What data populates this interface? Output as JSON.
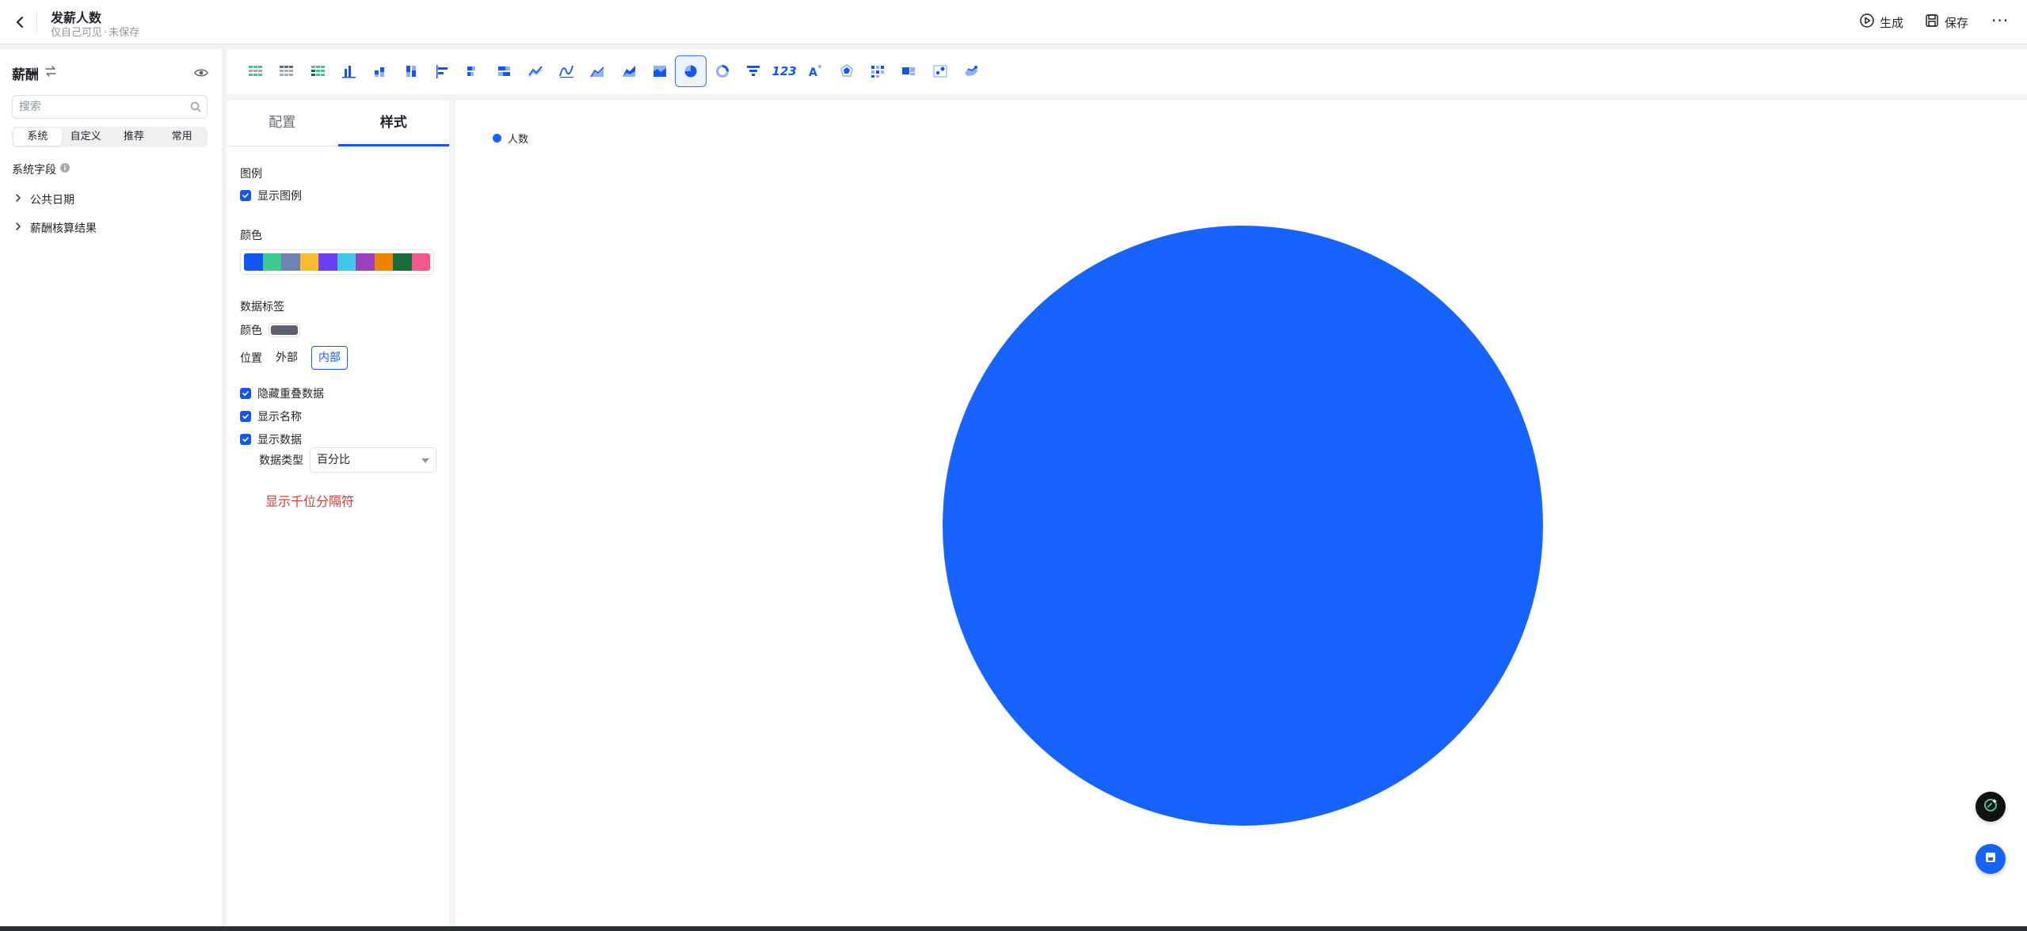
{
  "header": {
    "title": "发薪人数",
    "subtitle_visibility": "仅自己可见",
    "subtitle_status": "未保存",
    "generate_label": "生成",
    "save_label": "保存",
    "more_label": "···"
  },
  "sidebar": {
    "title": "薪酬",
    "search_placeholder": "搜索",
    "segments": [
      "系统",
      "自定义",
      "推荐",
      "常用"
    ],
    "active_segment": "系统",
    "section_label": "系统字段",
    "tree": [
      {
        "label": "公共日期"
      },
      {
        "label": "薪酬核算结果"
      }
    ]
  },
  "toolbar": {
    "chart_types": [
      "detail-table-icon",
      "cross-table-icon",
      "group-table-icon",
      "column-chart-icon",
      "stacked-column-icon",
      "percent-column-icon",
      "bar-chart-icon",
      "stacked-bar-icon",
      "percent-bar-icon",
      "line-chart-icon",
      "curve-line-icon",
      "area-chart-icon",
      "stacked-area-icon",
      "percent-area-icon",
      "pie-chart-icon",
      "donut-chart-icon",
      "funnel-chart-icon",
      "kpi-number-icon",
      "word-cloud-icon",
      "radar-chart-icon",
      "heatmap-icon",
      "combo-chart-icon",
      "scatter-chart-icon",
      "map-chart-icon"
    ],
    "active": "pie-chart-icon",
    "kpi_text": "123",
    "brand_color": "#1456f0"
  },
  "panel": {
    "tabs": [
      "配置",
      "样式"
    ],
    "active_tab": "样式",
    "legend_section": "图例",
    "show_legend_label": "显示图例",
    "show_legend": true,
    "color_section": "颜色",
    "palette": [
      "#1456f0",
      "#3ec991",
      "#6f82b3",
      "#fbbd2d",
      "#6a3ef5",
      "#3fc8e8",
      "#9b3fbf",
      "#f28300",
      "#1a6b3d",
      "#f5578c"
    ],
    "data_label_section": "数据标签",
    "color_label": "颜色",
    "label_color": "#5c6170",
    "position_label": "位置",
    "positions": [
      "外部",
      "内部"
    ],
    "active_position": "内部",
    "hide_overlap_label": "隐藏重叠数据",
    "hide_overlap": true,
    "show_name_label": "显示名称",
    "show_name": true,
    "show_data_label": "显示数据",
    "show_data": true,
    "data_type_label": "数据类型",
    "data_type_value": "百分比",
    "thousands_label": "显示千位分隔符"
  },
  "chart_data": {
    "type": "pie",
    "legend_placement": "top-left",
    "series": [
      {
        "name": "人数",
        "values": [
          1
        ]
      }
    ],
    "categories": [
      "人数"
    ],
    "colors": [
      "#1763ff"
    ]
  }
}
